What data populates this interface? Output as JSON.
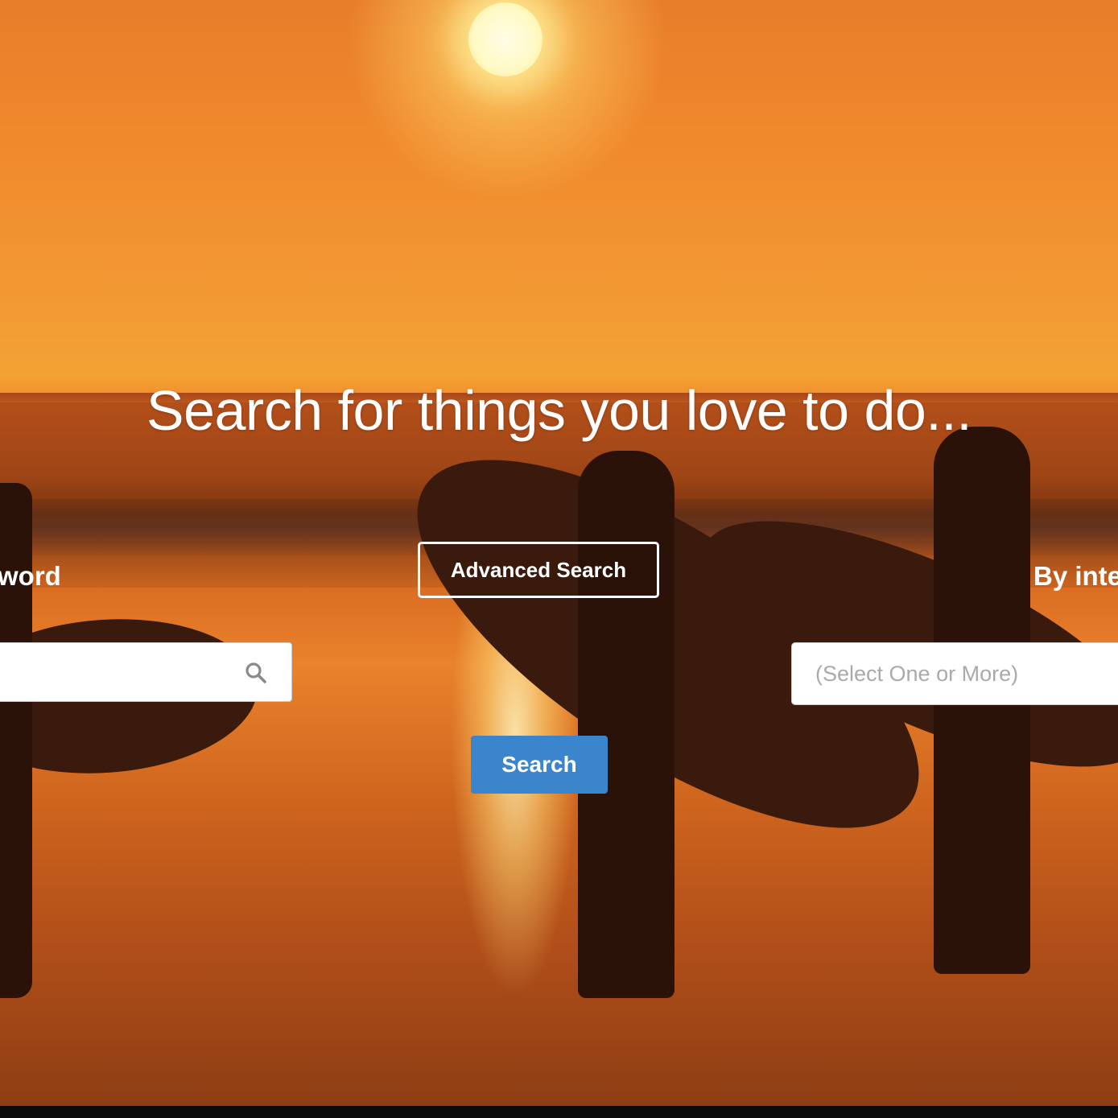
{
  "hero": {
    "headline": "Search for things you love to do...",
    "image_description": "sunset-beach-surfers-photo"
  },
  "search": {
    "keyword_label": "word",
    "keyword_placeholder": "",
    "advanced_label": "Advanced Search",
    "interest_label": "By inte",
    "interest_placeholder": "(Select One or More)",
    "submit_label": "Search"
  },
  "colors": {
    "accent": "#3a85cc",
    "text_light": "#ffffff",
    "placeholder": "#aaaaaa"
  },
  "icons": {
    "keyword_search": "search-icon"
  }
}
